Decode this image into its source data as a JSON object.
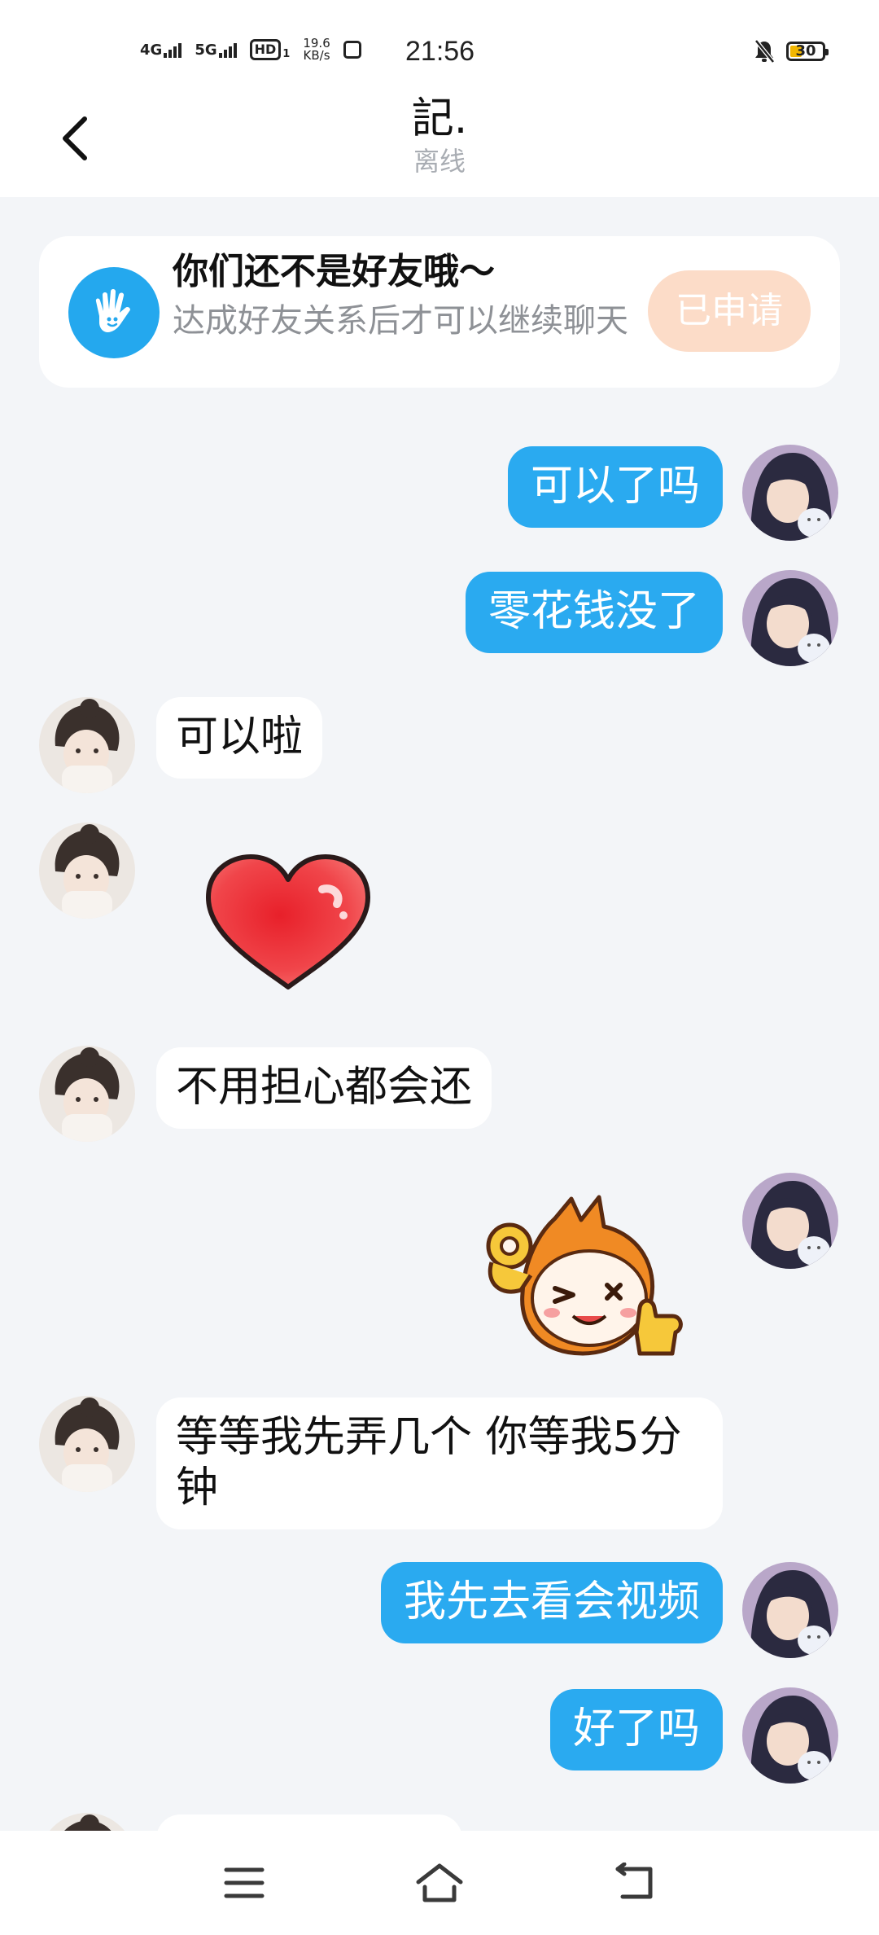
{
  "status_bar": {
    "time": "21:56",
    "net1": "4G",
    "net2": "5G",
    "hd": "HD",
    "hd_sub": "1",
    "speed_value": "19.6",
    "speed_unit": "KB/s",
    "battery": "30",
    "battery_color": "#f2b600"
  },
  "header": {
    "title": "記.",
    "subtitle": "离线"
  },
  "banner": {
    "title": "你们还不是好友哦～",
    "desc": "达成好友关系后才可以继续聊天",
    "button": "已申请",
    "icon": "waving-hand-icon"
  },
  "messages": [
    {
      "side": "sent",
      "type": "text",
      "text": "可以了吗"
    },
    {
      "side": "sent",
      "type": "text",
      "text": "零花钱没了"
    },
    {
      "side": "recv",
      "type": "text",
      "text": "可以啦"
    },
    {
      "side": "recv",
      "type": "sticker",
      "sticker": "red-heart-sticker"
    },
    {
      "side": "recv",
      "type": "text",
      "text": "不用担心都会还"
    },
    {
      "side": "sent",
      "type": "sticker",
      "sticker": "ok-thumbs-up-sticker"
    },
    {
      "side": "recv",
      "type": "text",
      "text": "等等我先弄几个 你等我5分钟"
    },
    {
      "side": "sent",
      "type": "text",
      "text": "我先去看会视频"
    },
    {
      "side": "sent",
      "type": "text",
      "text": "好了吗"
    }
  ],
  "colors": {
    "sent_bubble": "#2aaaf0",
    "background": "#f3f5f8",
    "apply_button": "#fcdcc8"
  },
  "nav": {
    "menu": "menu-icon",
    "home": "home-icon",
    "back": "back-arrow-icon"
  }
}
